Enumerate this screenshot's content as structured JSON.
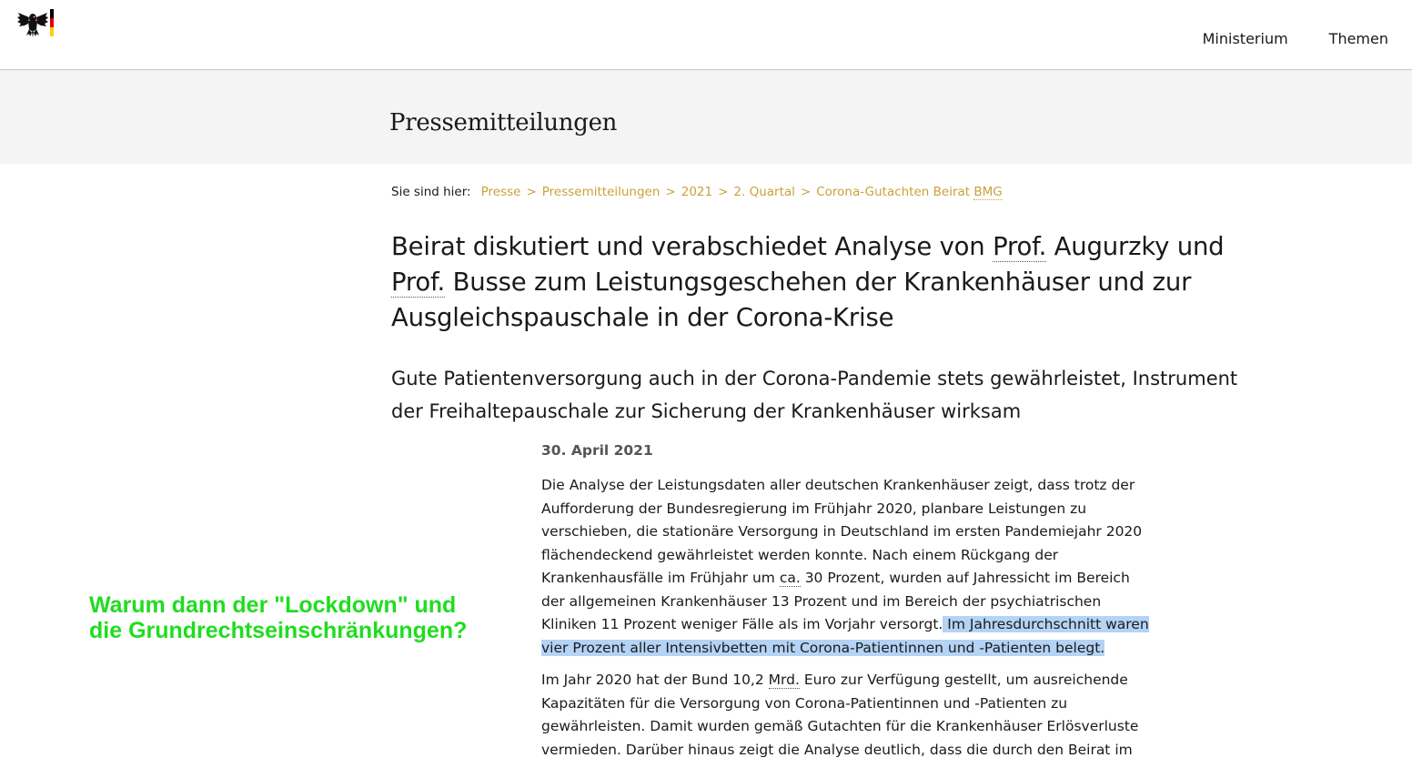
{
  "header": {
    "nav": [
      {
        "label": "Ministerium"
      },
      {
        "label": "Themen"
      }
    ],
    "flag_colors": [
      "#000000",
      "#dd0000",
      "#ffce00"
    ]
  },
  "section": {
    "title": "Pressemitteilungen"
  },
  "breadcrumb": {
    "label": "Sie sind hier:",
    "items": [
      "Presse",
      "Pressemitteilungen",
      "2021",
      "2. Quartal",
      "Corona-Gutachten Beirat "
    ],
    "last_abbr": "BMG",
    "separator": ">"
  },
  "article": {
    "headline_parts": [
      "Beirat diskutiert und verabschiedet Analyse von ",
      "Prof.",
      " Augurzky und ",
      "Prof.",
      " Busse zum Leistungsgeschehen der Krankenhäuser und zur Ausgleichspauschale in der Corona-Krise"
    ],
    "subline": "Gute Patientenversorgung auch in der Corona-Pandemie stets gewährleistet, Instrument der Freihaltepauschale zur Sicherung der Krankenhäuser wirksam",
    "date": "30. April 2021",
    "para1": {
      "l1": "Die Analyse der Leistungsdaten aller deutschen Krankenhäuser zeigt, dass trotz der",
      "l2": "Aufforderung der Bundesregierung im Frühjahr 2020, planbare Leistungen zu",
      "l3": "verschieben, die stationäre Versorgung in Deutschland im ersten Pandemiejahr 2020",
      "l4": "flächendeckend gewährleistet werden konnte. Nach einem Rückgang der",
      "l5a": "Krankenhausfälle im Frühjahr um ",
      "l5abbr": "ca.",
      "l5b": " 30 Prozent, wurden auf Jahressicht im Bereich",
      "l6": "der allgemeinen Krankenhäuser 13 Prozent und im Bereich der psychiatrischen",
      "l7a": "Kliniken 11 Prozent weniger Fälle als im Vorjahr versorgt.",
      "l7hl": " Im Jahresdurchschnitt waren",
      "l8hl": "vier Prozent aller Intensivbetten mit Corona-Patientinnen und -Patienten belegt."
    },
    "para2": {
      "l1a": "Im Jahr 2020 hat der Bund 10,2 ",
      "l1abbr": "Mrd.",
      "l1b": " Euro zur Verfügung gestellt, um ausreichende",
      "l2": "Kapazitäten für die Versorgung von Corona-Patientinnen und -Patienten zu",
      "l3": "gewährleisten. Damit wurden gemäß Gutachten für die Krankenhäuser Erlösverluste",
      "l4": "vermieden. Darüber hinaus zeigt die Analyse deutlich, dass die durch den Beirat im"
    }
  },
  "annotation": {
    "line1": "Warum dann der \"Lockdown\" und",
    "line2": "die Grundrechtseinschränkungen?",
    "color": "#1fdd1f"
  }
}
